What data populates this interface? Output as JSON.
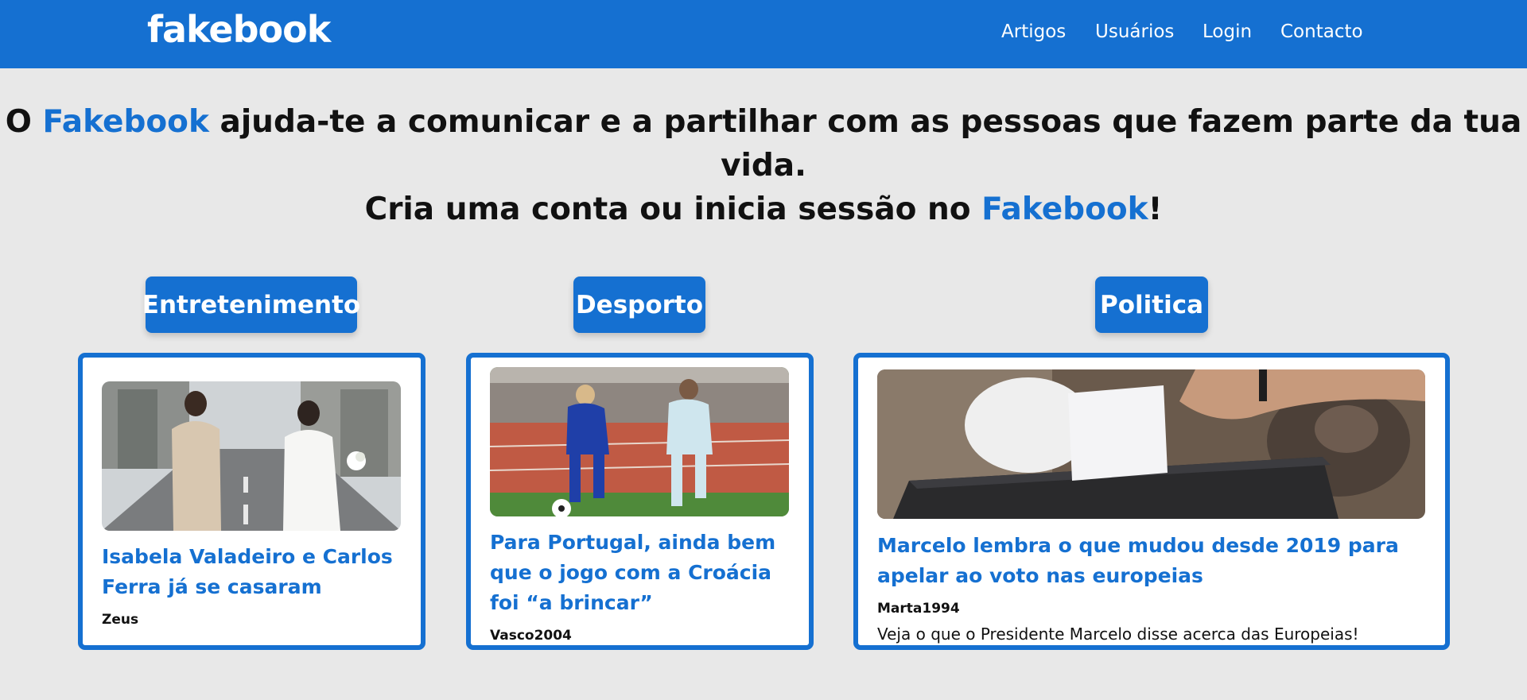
{
  "nav": {
    "logo": "fakebook",
    "links": [
      "Artigos",
      "Usuários",
      "Login",
      "Contacto"
    ]
  },
  "hero": {
    "line1_pre": "O ",
    "line1_brand": "Fakebook",
    "line1_post": " ajuda-te a comunicar e a partilhar com as pessoas que fazem parte da tua vida.",
    "line2_pre": "Cria uma conta ou inicia sessão no ",
    "line2_brand": "Fakebook",
    "line2_post": "!"
  },
  "categories": [
    "Entretenimento",
    "Desporto",
    "Politica"
  ],
  "articles": [
    {
      "title": "Isabela Valadeiro e Carlos Ferra já se casaram",
      "author": "Zeus",
      "image_icon": "wedding-photo"
    },
    {
      "title": "Para Portugal, ainda bem que o jogo com a Croácia foi “a brincar”",
      "author": "Vasco2004",
      "image_icon": "football-match-photo"
    },
    {
      "title": "Marcelo lembra o que mudou desde 2019 para apelar ao voto nas europeias",
      "author": "Marta1994",
      "description": "Veja o que o Presidente Marcelo disse acerca das Europeias!",
      "image_icon": "ballot-box-photo"
    }
  ],
  "colors": {
    "primary": "#1570d1",
    "background": "#e8e8e8",
    "card_bg": "#ffffff"
  }
}
